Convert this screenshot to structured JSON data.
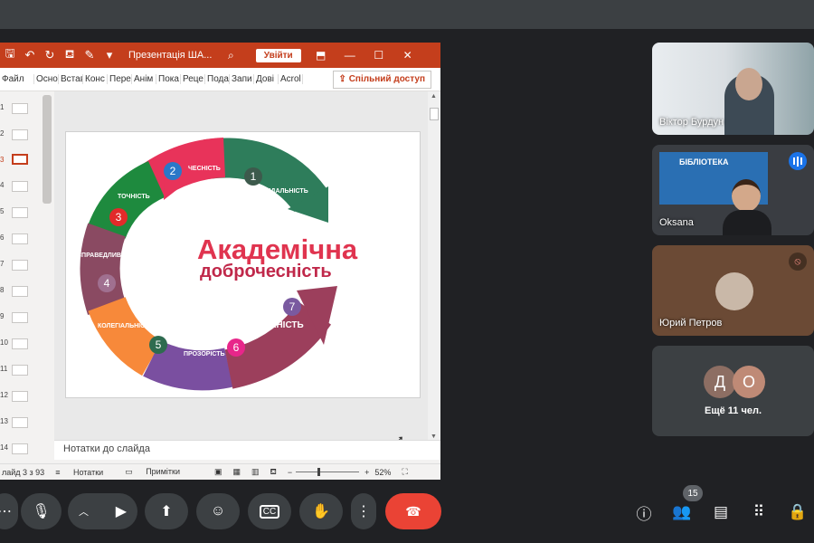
{
  "ppt": {
    "title": "Презентація ША...",
    "signin_label": "Увійти",
    "share_label": "Спільний доступ",
    "ribbon_tabs": [
      "Файл",
      "Осно",
      "Встав",
      "Конс",
      "Пере",
      "Анім",
      "Пока",
      "Реце",
      "Пода",
      "Запи",
      "Дові",
      "Acrol"
    ],
    "thumb_numbers": [
      "1",
      "2",
      "3",
      "4",
      "5",
      "6",
      "7",
      "8",
      "9",
      "10",
      "11",
      "12",
      "13",
      "14"
    ],
    "active_slide_index": 3,
    "notes_placeholder": "Нотатки до слайда",
    "status": {
      "slide_counter": "лайд 3 з 93",
      "notes_label": "Нотатки",
      "comments_label": "Примітки",
      "zoom": "52%"
    }
  },
  "slide": {
    "title_line1": "Академічна",
    "title_line2": "доброчесність",
    "segments": [
      {
        "num": "1",
        "label": "ВІДПОВІДАЛЬНІСТЬ",
        "color": "#2e7d5b"
      },
      {
        "num": "2",
        "label": "ЧЕСНІСТЬ",
        "color": "#e8335a"
      },
      {
        "num": "3",
        "label": "ТОЧНІСТЬ",
        "color": "#1e8a3e"
      },
      {
        "num": "4",
        "label": "СПРАВЕДЛИВІСТЬ",
        "color": "#8a4a62"
      },
      {
        "num": "5",
        "label": "КОЛЕГІАЛЬНІСТЬ",
        "color": "#f7893a"
      },
      {
        "num": "6",
        "label": "ПРОЗОРІСТЬ",
        "color": "#7a4fa0"
      },
      {
        "num": "7",
        "label": "ГУМАНІСТЬ",
        "color": "#9c3f5c"
      }
    ],
    "title_color": "#e0344f"
  },
  "participants": [
    {
      "name": "Віктор Бурдун"
    },
    {
      "name": "Oksana",
      "screen_text": "БІБЛІОТЕКА"
    },
    {
      "name": "Юрий Петров"
    }
  ],
  "others": {
    "avatars": [
      "Д",
      "О"
    ],
    "label": "Ещё 11 чел."
  },
  "people_count": "15",
  "colors": {
    "ppt_accent": "#c43e1c",
    "end_call": "#ea4335",
    "meet_bg": "#202124"
  }
}
